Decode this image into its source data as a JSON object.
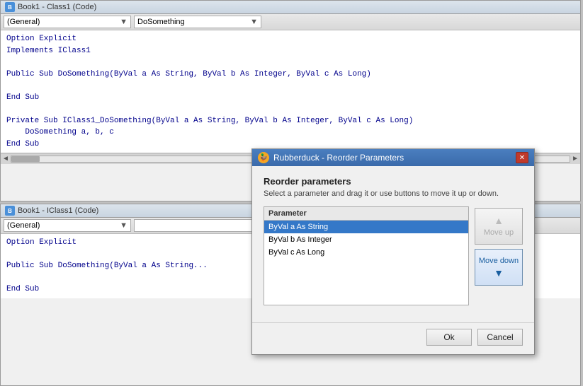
{
  "topPane": {
    "title": "Book1 - Class1 (Code)",
    "toolbar": {
      "left_dropdown": "(General)",
      "right_dropdown": "DoSomething"
    },
    "code": [
      "Option Explicit",
      "Implements IClass1",
      "",
      "Public Sub DoSomething(ByVal a As String, ByVal b As Integer, ByVal c As Long)",
      "",
      "End Sub",
      "",
      "Private Sub IClass1_DoSomething(ByVal a As String, ByVal b As Integer, ByVal c As Long)",
      "    DoSomething a, b, c",
      "End Sub"
    ]
  },
  "bottomPane": {
    "title": "Book1 - IClass1 (Code)",
    "toolbar": {
      "left_dropdown": "(General)",
      "right_dropdown": ""
    },
    "code": [
      "Option Explicit",
      "",
      "Public Sub DoSomething(ByVal a As String",
      "",
      "End Sub"
    ]
  },
  "dialog": {
    "title": "Rubberduck - Reorder Parameters",
    "heading": "Reorder parameters",
    "subtext": "Select a parameter and drag it or use buttons to move it up or down.",
    "paramList": {
      "header": "Parameter",
      "items": [
        {
          "label": "ByVal a As String",
          "selected": true
        },
        {
          "label": "ByVal b As Integer",
          "selected": false
        },
        {
          "label": "ByVal c As Long",
          "selected": false
        }
      ]
    },
    "moveUp": {
      "label": "Move up",
      "enabled": false
    },
    "moveDown": {
      "label": "Move down",
      "enabled": true
    },
    "okButton": "Ok",
    "cancelButton": "Cancel"
  }
}
